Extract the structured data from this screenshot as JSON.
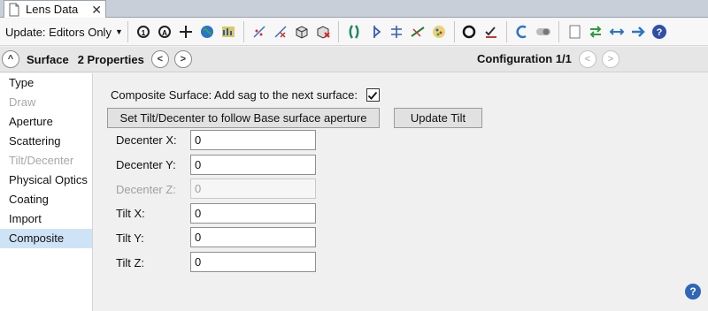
{
  "tab": {
    "title": "Lens Data",
    "close_glyph": "✕"
  },
  "toolbar": {
    "update_label": "Update: Editors Only",
    "icons": [
      "refresh-icon",
      "refresh-all-icon",
      "crosshair-icon",
      "globe-icon",
      "chart-icon",
      "scatter-icon",
      "scatter-red-icon",
      "cube-icon",
      "cube-error-icon",
      "lens-element-icon",
      "lens-flip-icon",
      "lens-tilt-icon",
      "ray-icon",
      "spot-icon",
      "circle-dropdown-icon",
      "check-pen-icon",
      "undo-arrow-icon",
      "toggle-icon",
      "page-icon",
      "swap-arrows-icon",
      "double-arrow-icon",
      "right-arrow-icon",
      "help-icon"
    ]
  },
  "propbar": {
    "collapse_glyph": "^",
    "surface_label": "Surface",
    "properties_count": "2 Properties",
    "prev_glyph": "<",
    "next_glyph": ">",
    "configuration_label": "Configuration 1/1"
  },
  "sidebar": {
    "items": [
      {
        "label": "Type",
        "state": "normal"
      },
      {
        "label": "Draw",
        "state": "disabled"
      },
      {
        "label": "Aperture",
        "state": "normal"
      },
      {
        "label": "Scattering",
        "state": "normal"
      },
      {
        "label": "Tilt/Decenter",
        "state": "disabled"
      },
      {
        "label": "Physical Optics",
        "state": "normal"
      },
      {
        "label": "Coating",
        "state": "normal"
      },
      {
        "label": "Import",
        "state": "normal"
      },
      {
        "label": "Composite",
        "state": "active"
      }
    ]
  },
  "composite": {
    "checkbox_label": "Composite Surface: Add sag to the next surface:",
    "checked": true,
    "follow_button": "Set Tilt/Decenter to follow Base surface aperture",
    "update_button": "Update Tilt",
    "fields": [
      {
        "label": "Decenter X:",
        "value": "0",
        "disabled": false
      },
      {
        "label": "Decenter Y:",
        "value": "0",
        "disabled": false
      },
      {
        "label": "Decenter Z:",
        "value": "0",
        "disabled": true
      },
      {
        "label": "Tilt X:",
        "value": "0",
        "disabled": false
      },
      {
        "label": "Tilt Y:",
        "value": "0",
        "disabled": false
      },
      {
        "label": "Tilt Z:",
        "value": "0",
        "disabled": false
      }
    ],
    "help_glyph": "?"
  },
  "colors": {
    "accent": "#2f66b8",
    "active_row": "#cfe3f7"
  }
}
